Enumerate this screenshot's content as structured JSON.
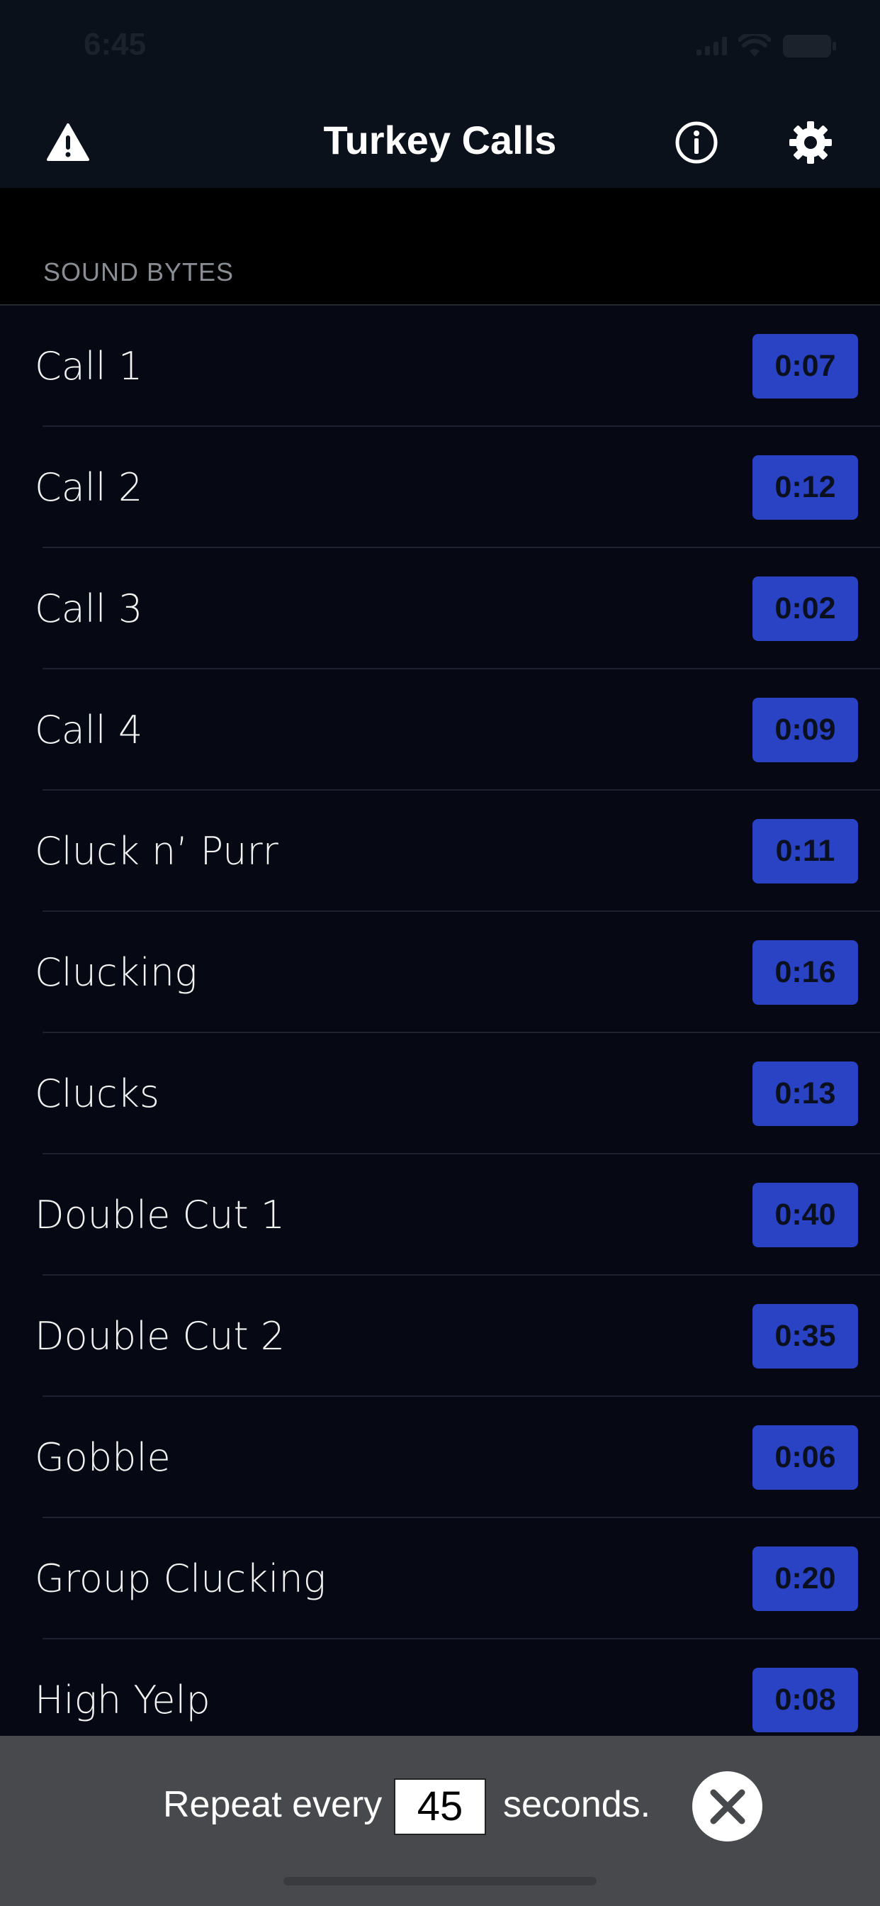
{
  "status_bar": {
    "time": "6:45"
  },
  "nav": {
    "title": "Turkey Calls",
    "left_icon": "warning-icon",
    "right_icons": [
      "info-icon",
      "gear-icon"
    ]
  },
  "section": {
    "header": "SOUND BYTES"
  },
  "sounds": [
    {
      "label": "Call 1",
      "duration": "0:07"
    },
    {
      "label": "Call 2",
      "duration": "0:12"
    },
    {
      "label": "Call 3",
      "duration": "0:02"
    },
    {
      "label": "Call 4",
      "duration": "0:09"
    },
    {
      "label": "Cluck n’ Purr",
      "duration": "0:11"
    },
    {
      "label": "Clucking",
      "duration": "0:16"
    },
    {
      "label": "Clucks",
      "duration": "0:13"
    },
    {
      "label": "Double Cut 1",
      "duration": "0:40"
    },
    {
      "label": "Double Cut 2",
      "duration": "0:35"
    },
    {
      "label": "Gobble",
      "duration": "0:06"
    },
    {
      "label": "Group Clucking",
      "duration": "0:20"
    },
    {
      "label": "High Yelp",
      "duration": "0:08"
    }
  ],
  "repeat_bar": {
    "prefix": "Repeat every",
    "value": "45",
    "suffix": "seconds.",
    "close_icon": "close-icon"
  },
  "colors": {
    "nav_background": "#0a111b",
    "list_background": "#060913",
    "badge_blue": "#2a42c4",
    "bottom_bar": "#48494c"
  }
}
